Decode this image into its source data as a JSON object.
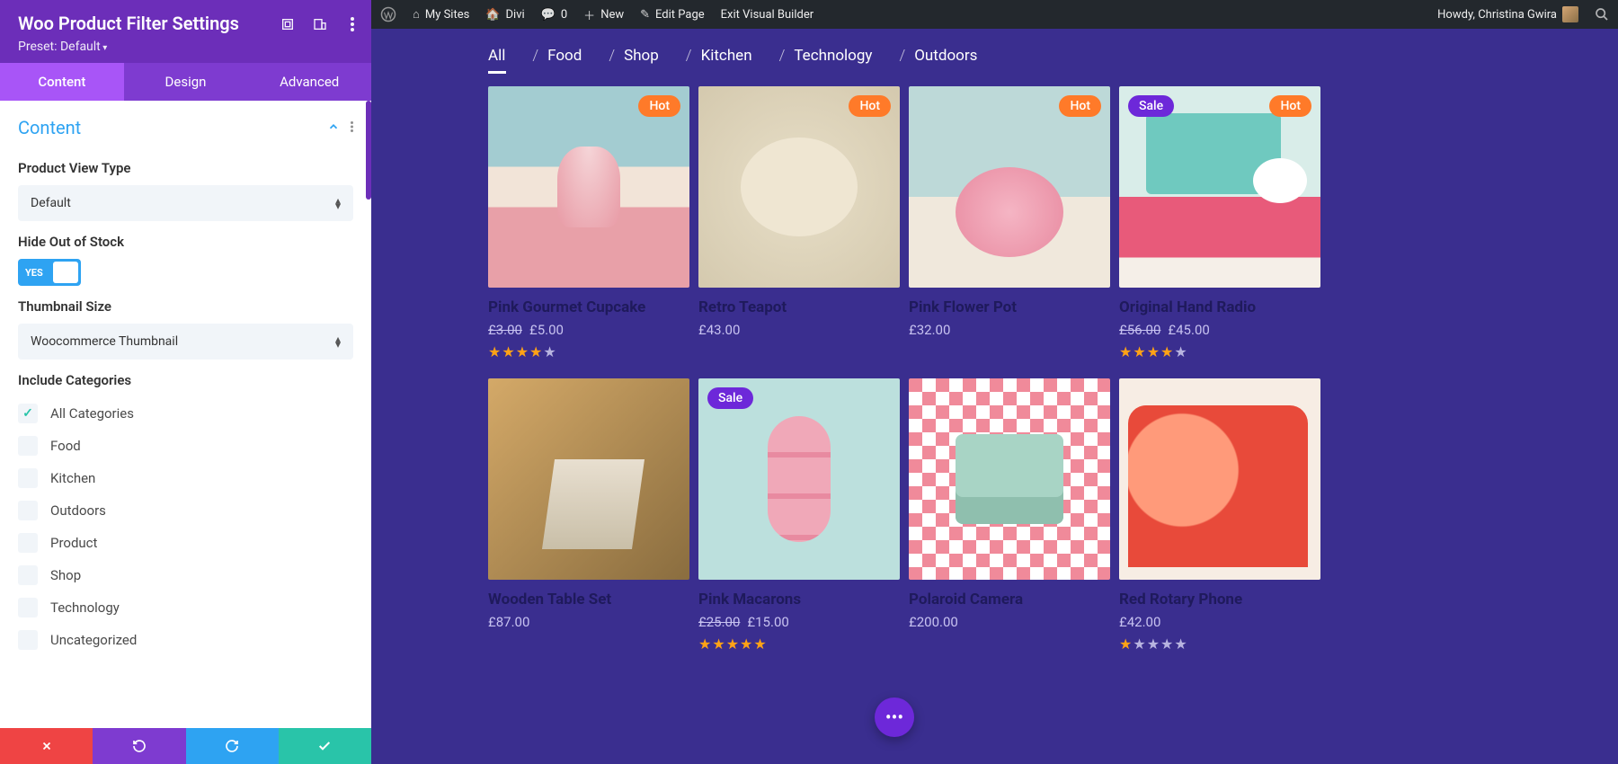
{
  "sidebar": {
    "title": "Woo Product Filter Settings",
    "preset": "Preset: Default",
    "tabs": [
      "Content",
      "Design",
      "Advanced"
    ],
    "active_tab": 0,
    "section": "Content",
    "fields": {
      "product_view_type": {
        "label": "Product View Type",
        "value": "Default"
      },
      "hide_out_of_stock": {
        "label": "Hide Out of Stock",
        "toggle": "YES"
      },
      "thumbnail_size": {
        "label": "Thumbnail Size",
        "value": "Woocommerce Thumbnail"
      },
      "include_categories": {
        "label": "Include Categories",
        "items": [
          {
            "label": "All Categories",
            "checked": true
          },
          {
            "label": "Food",
            "checked": false
          },
          {
            "label": "Kitchen",
            "checked": false
          },
          {
            "label": "Outdoors",
            "checked": false
          },
          {
            "label": "Product",
            "checked": false
          },
          {
            "label": "Shop",
            "checked": false
          },
          {
            "label": "Technology",
            "checked": false
          },
          {
            "label": "Uncategorized",
            "checked": false
          }
        ]
      }
    }
  },
  "adminbar": {
    "my_sites": "My Sites",
    "divi": "Divi",
    "comments": "0",
    "new": "New",
    "edit_page": "Edit Page",
    "exit_vb": "Exit Visual Builder",
    "howdy": "Howdy, Christina Gwira"
  },
  "filterbar": {
    "items": [
      "All",
      "Food",
      "Shop",
      "Kitchen",
      "Technology",
      "Outdoors"
    ],
    "active": 0
  },
  "products": [
    {
      "title": "Pink Gourmet Cupcake",
      "price_old": "£3.00",
      "price": "£5.00",
      "rating": 4,
      "badges": [
        "hot"
      ],
      "img": "cupcake"
    },
    {
      "title": "Retro Teapot",
      "price": "£43.00",
      "badges": [
        "hot"
      ],
      "img": "teapot"
    },
    {
      "title": "Pink Flower Pot",
      "price": "£32.00",
      "badges": [
        "hot"
      ],
      "img": "flowerpot"
    },
    {
      "title": "Original Hand Radio",
      "price_old": "£56.00",
      "price": "£45.00",
      "rating": 4,
      "badges": [
        "sale",
        "hot"
      ],
      "img": "radio"
    },
    {
      "title": "Wooden Table Set",
      "price": "£87.00",
      "badges": [],
      "img": "tableset"
    },
    {
      "title": "Pink Macarons",
      "price_old": "£25.00",
      "price": "£15.00",
      "rating": 5,
      "badges": [
        "sale"
      ],
      "img": "macarons"
    },
    {
      "title": "Polaroid Camera",
      "price": "£200.00",
      "badges": [],
      "img": "camera"
    },
    {
      "title": "Red Rotary Phone",
      "price": "£42.00",
      "rating": 1,
      "badges": [],
      "img": "phone"
    }
  ],
  "badge_labels": {
    "hot": "Hot",
    "sale": "Sale"
  }
}
